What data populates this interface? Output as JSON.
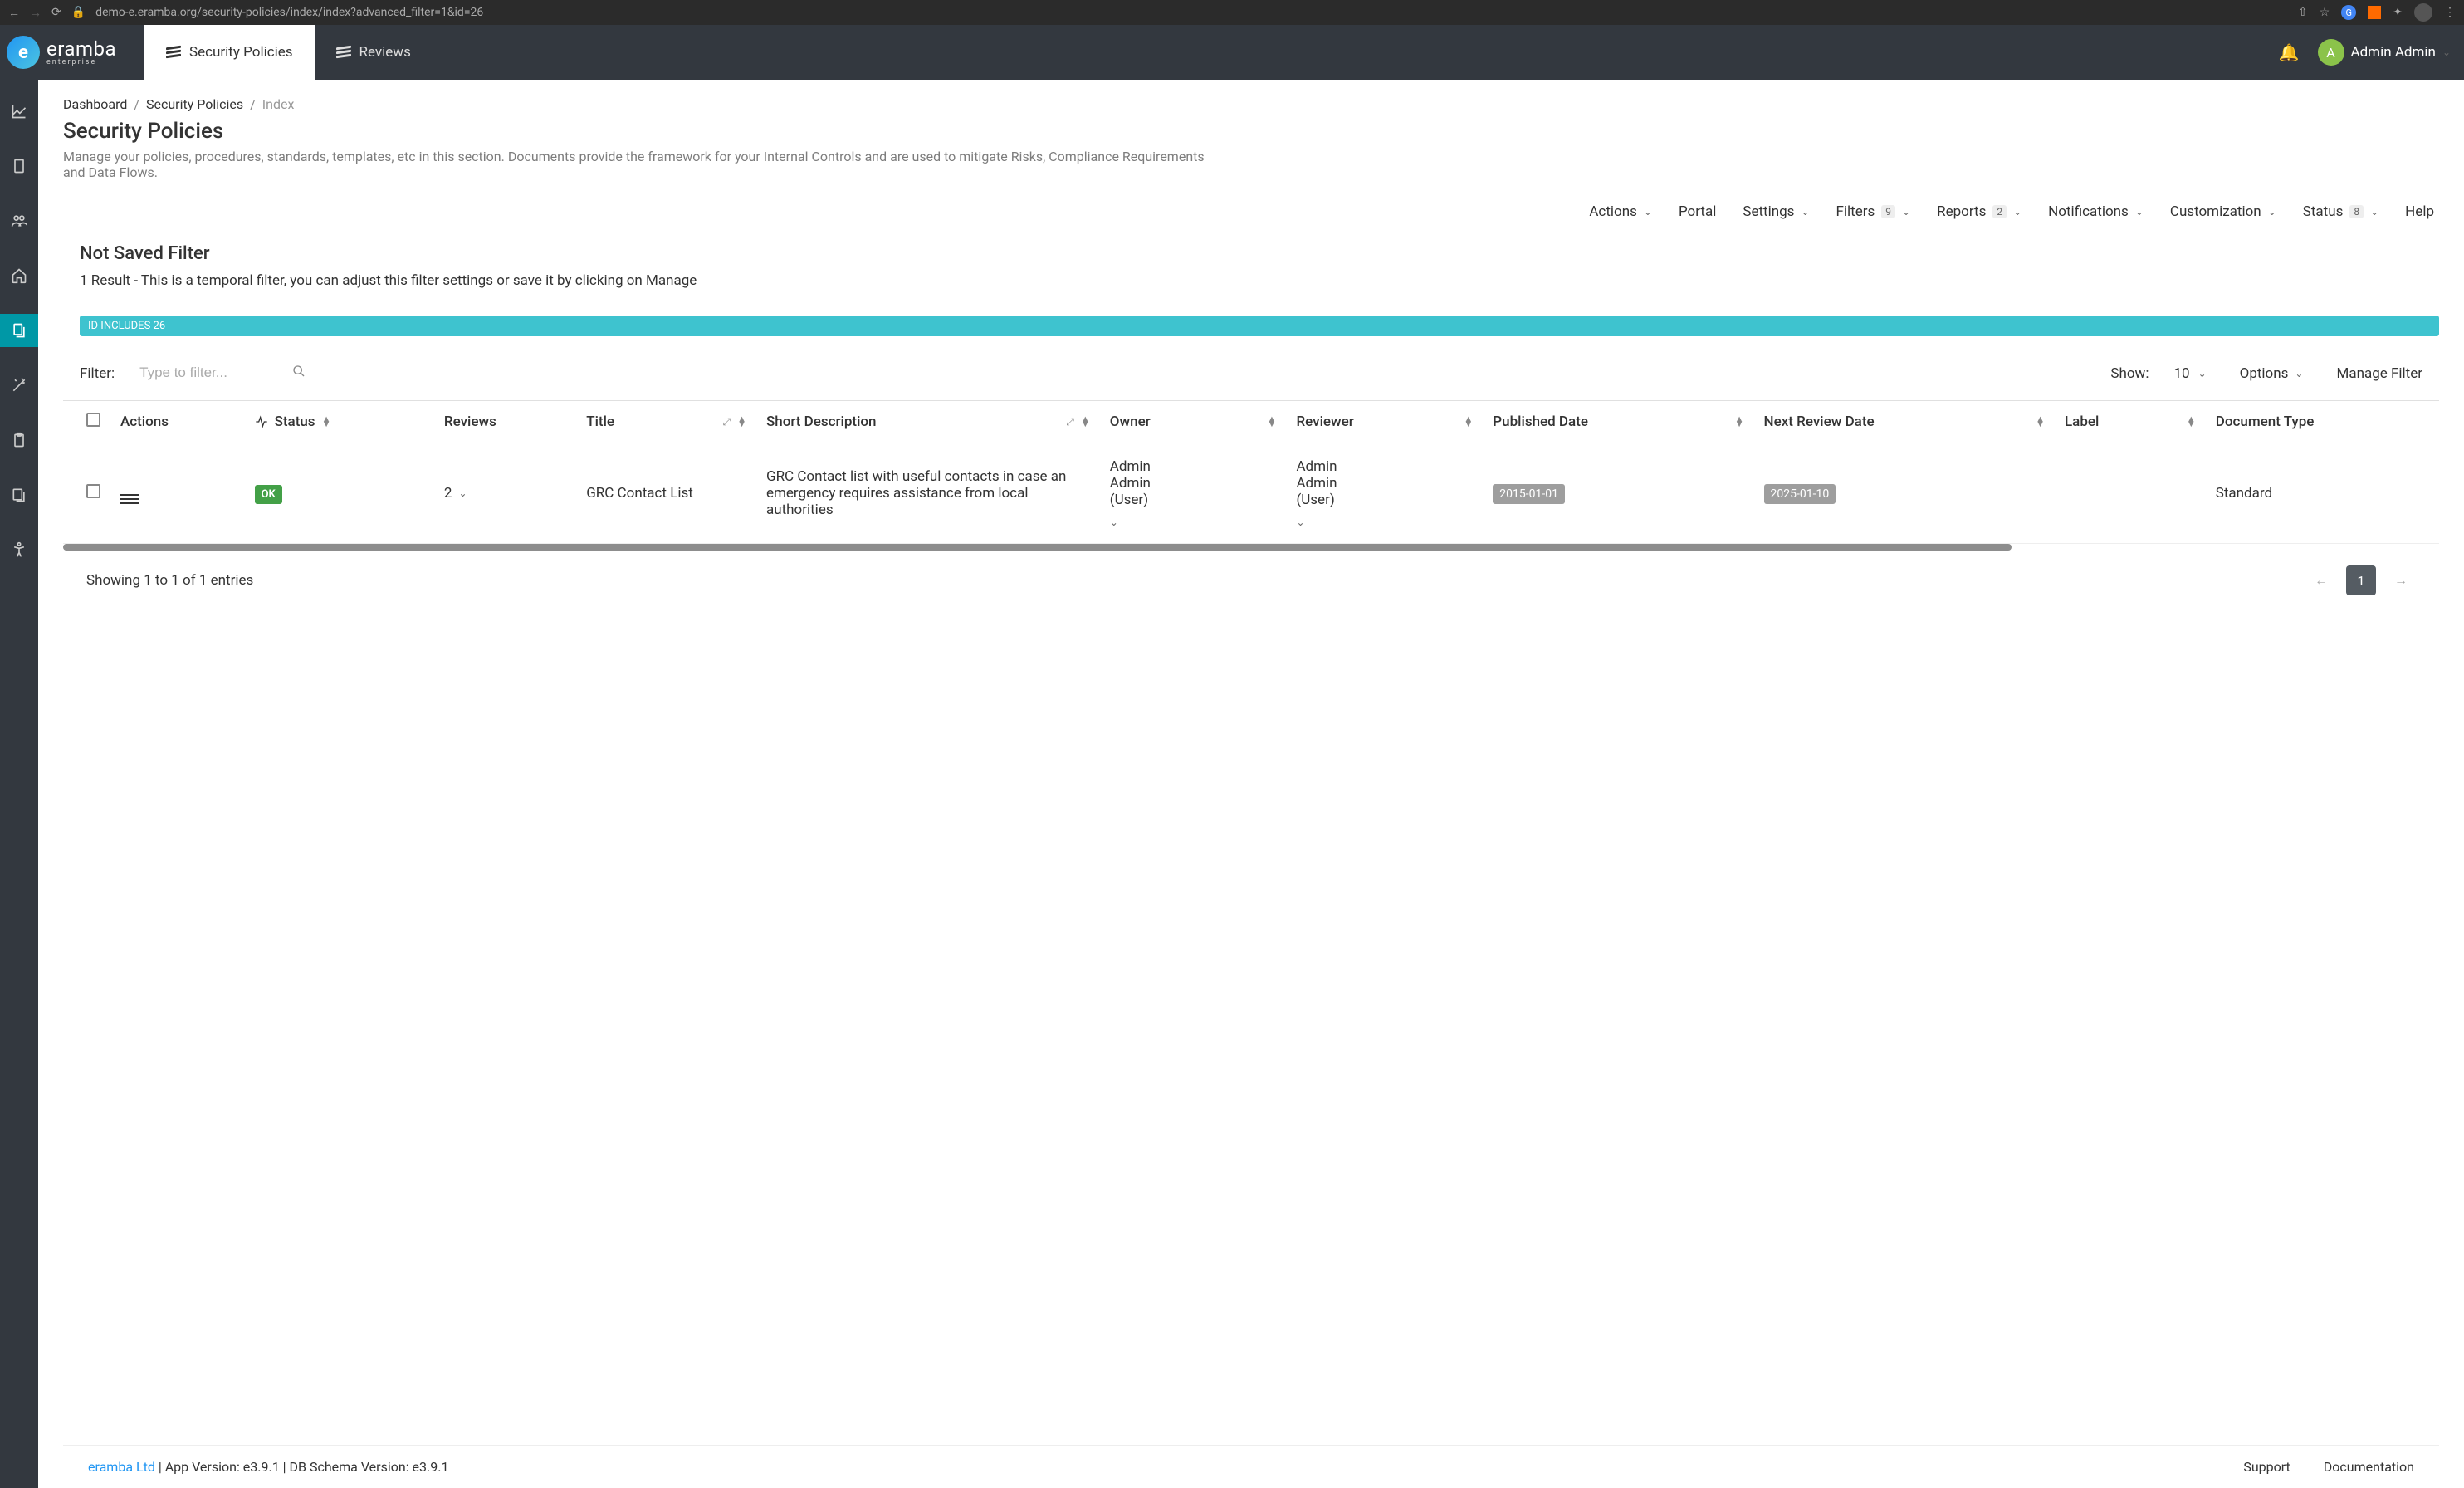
{
  "browser": {
    "url": "demo-e.eramba.org/security-policies/index/index?advanced_filter=1&id=26"
  },
  "header": {
    "brand": "eramba",
    "brand_sub": "enterprise",
    "tabs": [
      {
        "label": "Security Policies",
        "active": true
      },
      {
        "label": "Reviews",
        "active": false
      }
    ],
    "user_initial": "A",
    "user_name": "Admin Admin"
  },
  "breadcrumb": {
    "items": [
      "Dashboard",
      "Security Policies",
      "Index"
    ]
  },
  "page": {
    "title": "Security Policies",
    "description": "Manage your policies, procedures, standards, templates, etc in this section. Documents provide the framework for your Internal Controls and are used to mitigate Risks, Compliance Requirements and Data Flows."
  },
  "toolbar": {
    "actions": "Actions",
    "portal": "Portal",
    "settings": "Settings",
    "filters": "Filters",
    "filters_badge": "9",
    "reports": "Reports",
    "reports_badge": "2",
    "notifications": "Notifications",
    "customization": "Customization",
    "status": "Status",
    "status_badge": "8",
    "help": "Help"
  },
  "filter": {
    "title": "Not Saved Filter",
    "result_text": "1 Result - This is a temporal filter, you can adjust this filter settings or save it by clicking on Manage",
    "chip": "ID INCLUDES 26",
    "label": "Filter:",
    "placeholder": "Type to filter...",
    "show_label": "Show:",
    "show_value": "10",
    "options": "Options",
    "manage": "Manage Filter"
  },
  "table": {
    "columns": {
      "actions": "Actions",
      "status": "Status",
      "reviews": "Reviews",
      "title": "Title",
      "short_desc": "Short Description",
      "owner": "Owner",
      "reviewer": "Reviewer",
      "published": "Published Date",
      "next_review": "Next Review Date",
      "label": "Label",
      "doc_type": "Document Type"
    },
    "rows": [
      {
        "status": "OK",
        "reviews": "2",
        "title": "GRC Contact List",
        "short_desc": "GRC Contact list with useful contacts in case an emergency requires assistance from local authorities",
        "owner": "Admin Admin (User)",
        "reviewer": "Admin Admin (User)",
        "published": "2015-01-01",
        "next_review": "2025-01-10",
        "label": "",
        "doc_type": "Standard"
      }
    ]
  },
  "pagination": {
    "summary": "Showing 1 to 1 of 1 entries",
    "prev": "←",
    "next": "→",
    "current": "1"
  },
  "footer": {
    "company": "eramba Ltd",
    "version_text": " | App Version: e3.9.1 | DB Schema Version: e3.9.1",
    "support": "Support",
    "documentation": "Documentation"
  }
}
